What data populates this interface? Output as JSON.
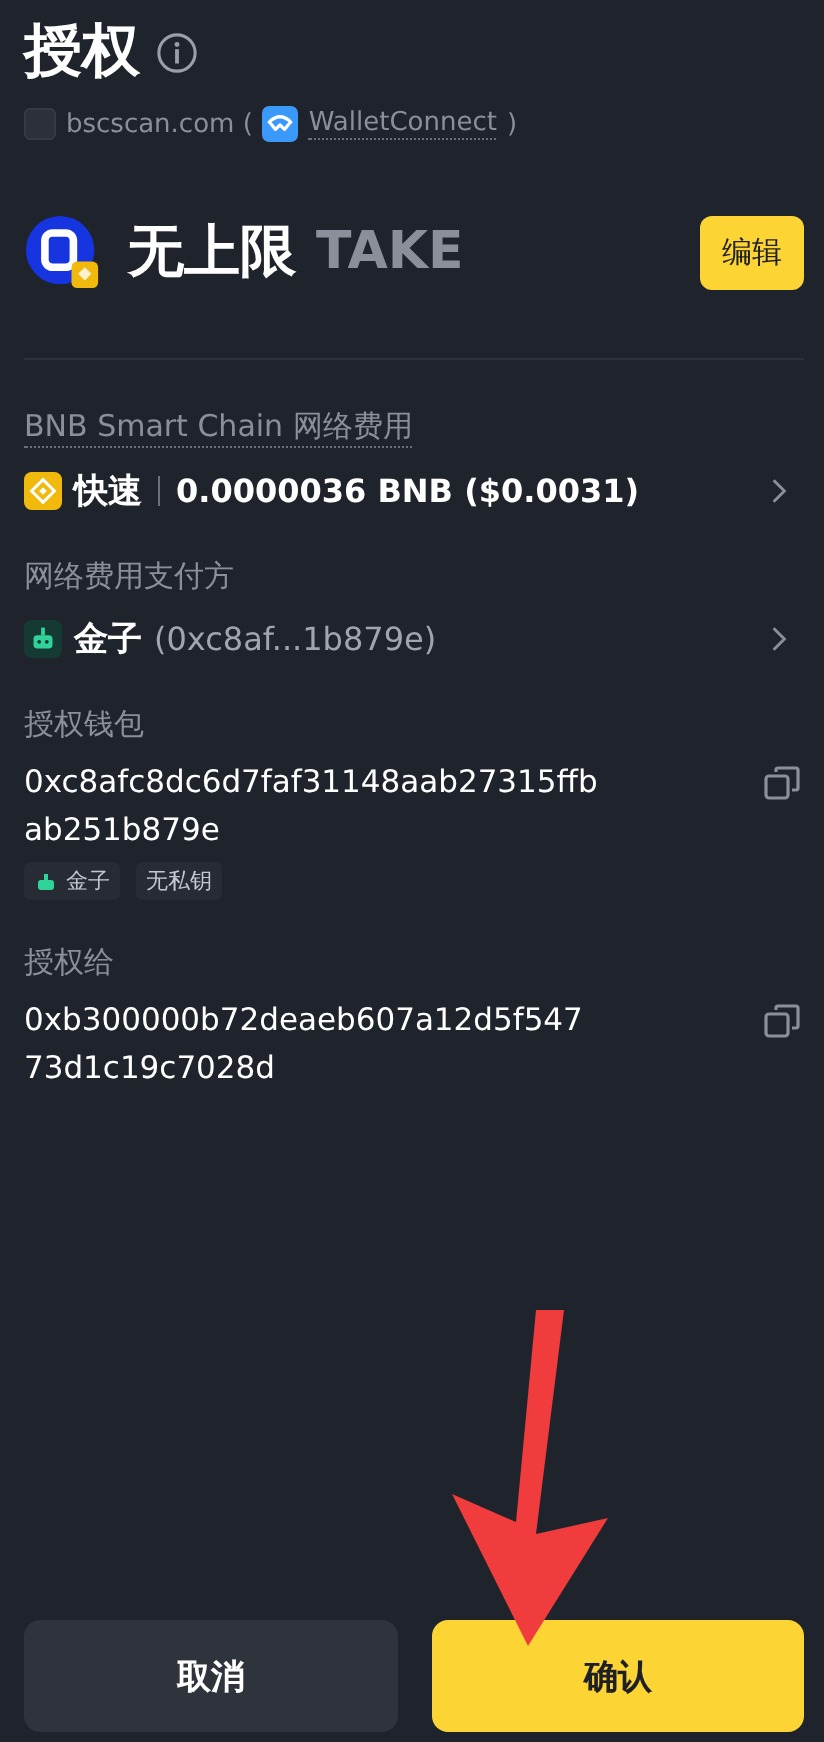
{
  "title": "授权",
  "source": {
    "site": "bscscan.com (",
    "connector": "WalletConnect",
    "close": ")"
  },
  "token": {
    "amount": "无上限",
    "symbol": "TAKE",
    "edit_button": "编辑"
  },
  "fee": {
    "label": "BNB Smart Chain 网络费用",
    "speed": "快速",
    "amount": "0.0000036 BNB ($0.0031)"
  },
  "payer": {
    "label": "网络费用支付方",
    "name": "金子",
    "address": "(0xc8af...1b879e)"
  },
  "wallet": {
    "label": "授权钱包",
    "address_lines": [
      "0xc8afc8dc6d7faf31148aab27315ffb",
      "ab251b879e"
    ],
    "tags": [
      {
        "kind": "account",
        "text": "金子"
      },
      {
        "kind": "plain",
        "text": "无私钥"
      }
    ]
  },
  "spender": {
    "label": "授权给",
    "address_lines": [
      "0xb300000b72deaeb607a12d5f547",
      "73d1c19c7028d"
    ]
  },
  "buttons": {
    "cancel": "取消",
    "confirm": "确认"
  }
}
